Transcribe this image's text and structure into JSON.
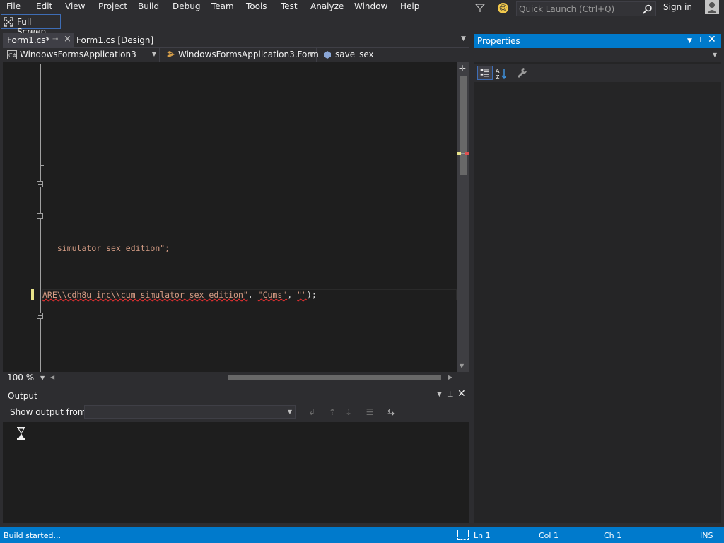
{
  "menu": {
    "items": [
      "File",
      "Edit",
      "View",
      "Project",
      "Build",
      "Debug",
      "Team",
      "Tools",
      "Test",
      "Analyze",
      "Window",
      "Help"
    ]
  },
  "quick_launch": {
    "placeholder": "Quick Launch (Ctrl+Q)"
  },
  "signin_label": "Sign in",
  "fullscreen_label": "Full Screen",
  "tabs": [
    {
      "label": "Form1.cs*",
      "active": true
    },
    {
      "label": "Form1.cs [Design]",
      "active": false
    }
  ],
  "navbar": {
    "project": "WindowsFormsApplication3",
    "class": "WindowsFormsApplication3.Form",
    "member": "save_sex"
  },
  "code": {
    "line1": "simulator sex edition\";",
    "line2_a": "ARE\\\\cdh8u inc\\\\cum simulator sex edition\"",
    "line2_b": ", ",
    "line2_c": "\"Cums\"",
    "line2_d": ", ",
    "line2_e": "\"\"",
    "line2_f": ");"
  },
  "zoom": "100 %",
  "output": {
    "title": "Output",
    "show_from_label": "Show output from:",
    "show_from_value": ""
  },
  "properties": {
    "title": "Properties"
  },
  "status": {
    "message": "Build started...",
    "ln": "Ln 1",
    "col": "Col 1",
    "ch": "Ch 1",
    "mode": "INS"
  },
  "colors": {
    "accent": "#007acc",
    "background": "#2d2d30",
    "editor": "#1e1e1e",
    "string": "#d69d85"
  }
}
